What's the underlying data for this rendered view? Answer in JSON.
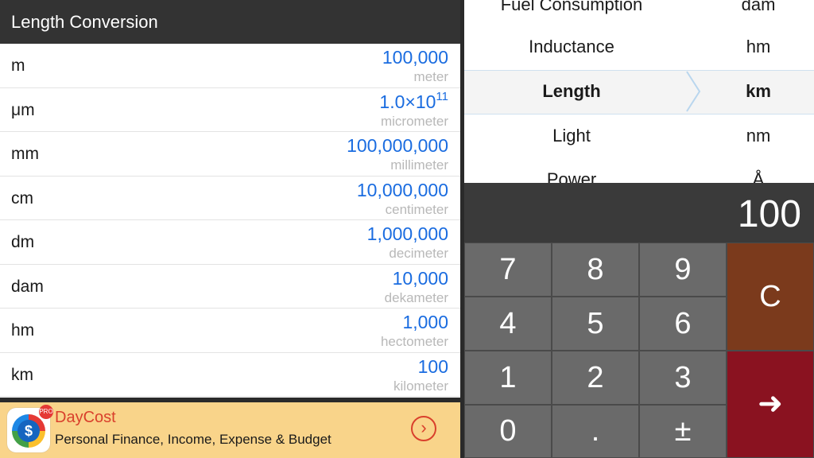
{
  "header": {
    "title": "Length Conversion"
  },
  "conversions": [
    {
      "symbol": "m",
      "value": "100,000",
      "name": "meter"
    },
    {
      "symbol": "μm",
      "value_base": "1.0×10",
      "value_exp": "11",
      "name": "micrometer"
    },
    {
      "symbol": "mm",
      "value": "100,000,000",
      "name": "millimeter"
    },
    {
      "symbol": "cm",
      "value": "10,000,000",
      "name": "centimeter"
    },
    {
      "symbol": "dm",
      "value": "1,000,000",
      "name": "decimeter"
    },
    {
      "symbol": "dam",
      "value": "10,000",
      "name": "dekameter"
    },
    {
      "symbol": "hm",
      "value": "1,000",
      "name": "hectometer"
    },
    {
      "symbol": "km",
      "value": "100",
      "name": "kilometer"
    }
  ],
  "ad": {
    "title": "DayCost",
    "subtitle": "Personal Finance, Income, Expense & Budget",
    "icon_symbol": "$",
    "icon_badge": "PRO",
    "arrow": "›"
  },
  "picker": {
    "categories": [
      "Fuel Consumption",
      "Inductance",
      "Length",
      "Light",
      "Power"
    ],
    "units": [
      "dam",
      "hm",
      "km",
      "nm",
      "Å"
    ],
    "selected_index": 2
  },
  "display": {
    "value": "100"
  },
  "keypad": {
    "keys": [
      "7",
      "8",
      "9",
      "4",
      "5",
      "6",
      "1",
      "2",
      "3",
      "0",
      ".",
      "±"
    ],
    "clear": "C",
    "enter": "➜"
  },
  "colors": {
    "value_blue": "#1a6ce0",
    "clear_key": "#7b3a1c",
    "enter_key": "#8a1220",
    "ad_background": "#f9d48a",
    "ad_accent": "#d9402c"
  }
}
